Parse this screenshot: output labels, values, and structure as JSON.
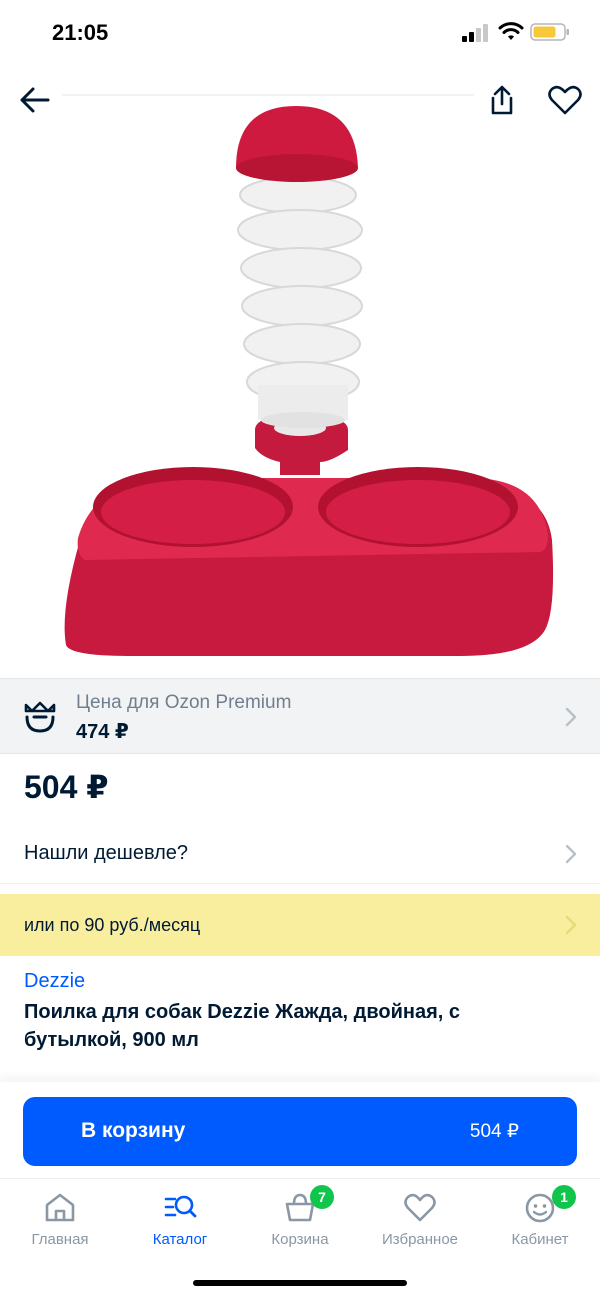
{
  "status_bar": {
    "time": "21:05"
  },
  "colors": {
    "accent": "#005bff",
    "installment_bg": "#f9ee9e",
    "badge": "#10c44c",
    "premium_bg": "#f2f3f5",
    "product_red": "#d81d45"
  },
  "nav": {
    "back_icon": "arrow-left-icon",
    "share_icon": "share-icon",
    "favorite_icon": "heart-icon"
  },
  "premium": {
    "label": "Цена для Ozon Premium",
    "price": "474 ₽",
    "icon": "ozon-premium-icon"
  },
  "price": {
    "main": "504 ₽"
  },
  "cheaper": {
    "label": "Нашли дешевле?"
  },
  "installment": {
    "label": "или по 90 руб./месяц"
  },
  "product": {
    "brand": "Dezzie",
    "title": "Поилка для собак Dezzie Жажда, двойная, с бутылкой, 900 мл"
  },
  "cart": {
    "label": "В корзину",
    "price": "504 ₽"
  },
  "tabs": [
    {
      "label": "Главная",
      "icon": "home-icon"
    },
    {
      "label": "Каталог",
      "icon": "catalog-search-icon",
      "active": true
    },
    {
      "label": "Корзина",
      "icon": "basket-icon",
      "badge": "7"
    },
    {
      "label": "Избранное",
      "icon": "heart-icon"
    },
    {
      "label": "Кабинет",
      "icon": "profile-icon",
      "badge": "1"
    }
  ]
}
